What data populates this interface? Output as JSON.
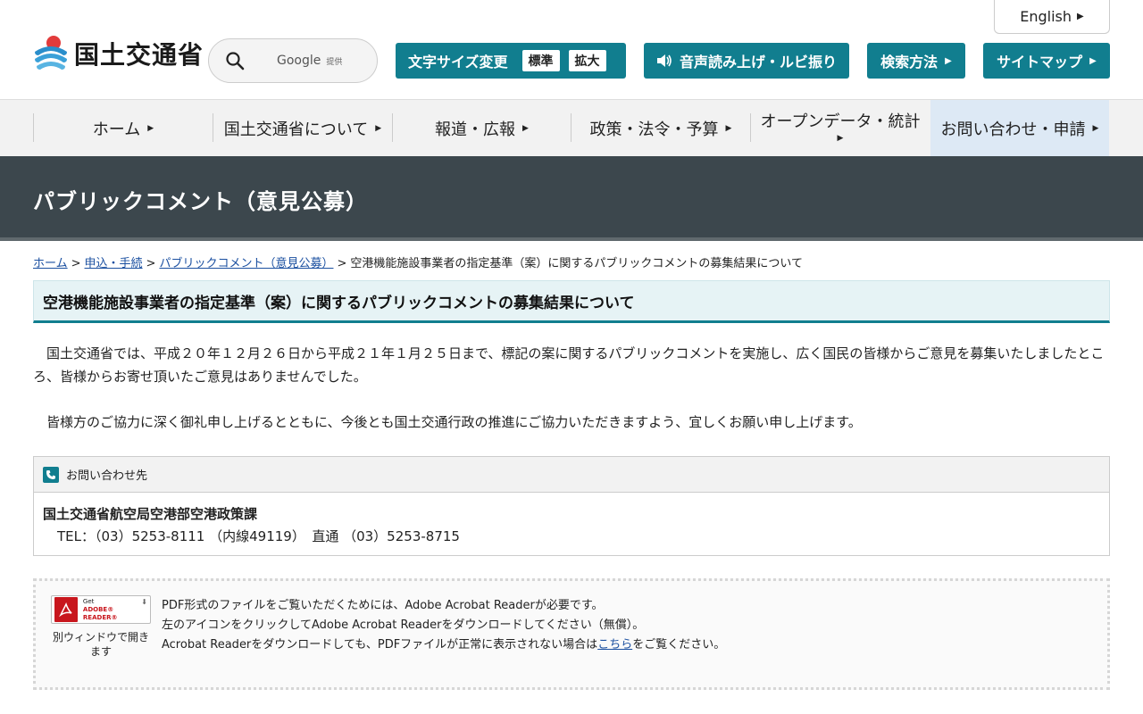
{
  "header": {
    "english_label": "English",
    "logo_text": "国土交通省",
    "search_provider": "Google",
    "search_provider_suffix": "提供",
    "font_size_label": "文字サイズ変更",
    "font_size_standard": "標準",
    "font_size_large": "拡大",
    "voice_label": "音声読み上げ・ルビ振り",
    "search_method_label": "検索方法",
    "sitemap_label": "サイトマップ"
  },
  "nav": {
    "items": [
      {
        "label": "ホーム"
      },
      {
        "label": "国土交通省について"
      },
      {
        "label": "報道・広報"
      },
      {
        "label": "政策・法令・予算"
      },
      {
        "label": "オープンデータ・統計"
      },
      {
        "label": "お問い合わせ・申請"
      }
    ]
  },
  "banner": {
    "title": "パブリックコメント（意見公募）"
  },
  "breadcrumb": {
    "home": "ホーム",
    "application": "申込・手続",
    "public_comment": "パブリックコメント（意見公募）",
    "current": "空港機能施設事業者の指定基準（案）に関するパブリックコメントの募集結果について",
    "separator": ">"
  },
  "main": {
    "title": "空港機能施設事業者の指定基準（案）に関するパブリックコメントの募集結果について",
    "paragraph1": "国土交通省では、平成２０年１２月２６日から平成２１年１月２５日まで、標記の案に関するパブリックコメントを実施し、広く国民の皆様からご意見を募集いたしましたところ、皆様からお寄せ頂いたご意見はありませんでした。",
    "paragraph2": "皆様方のご協力に深く御礼申し上げるとともに、今後とも国土交通行政の推進にご協力いただきますよう、宜しくお願い申し上げます。"
  },
  "contact": {
    "heading": "お問い合わせ先",
    "organization": "国土交通省航空局空港部空港政策課",
    "tel": "TEL：（03）5253-8111 （内線49119）　直通 （03）5253-8715"
  },
  "pdf": {
    "adobe_get": "Get",
    "adobe_name": "ADOBE® READER®",
    "new_window": "別ウィンドウで開きます",
    "line1": "PDF形式のファイルをご覧いただくためには、Adobe Acrobat Readerが必要です。",
    "line2": "左のアイコンをクリックしてAdobe Acrobat Readerをダウンロードしてください（無償）。",
    "line3_prefix": "Acrobat Readerをダウンロードしても、PDFファイルが正常に表示されない場合は",
    "line3_link": "こちら",
    "line3_suffix": "をご覧ください。"
  },
  "colors": {
    "accent": "#117e8f",
    "banner": "#3c474d",
    "link": "#1a4fa0"
  }
}
